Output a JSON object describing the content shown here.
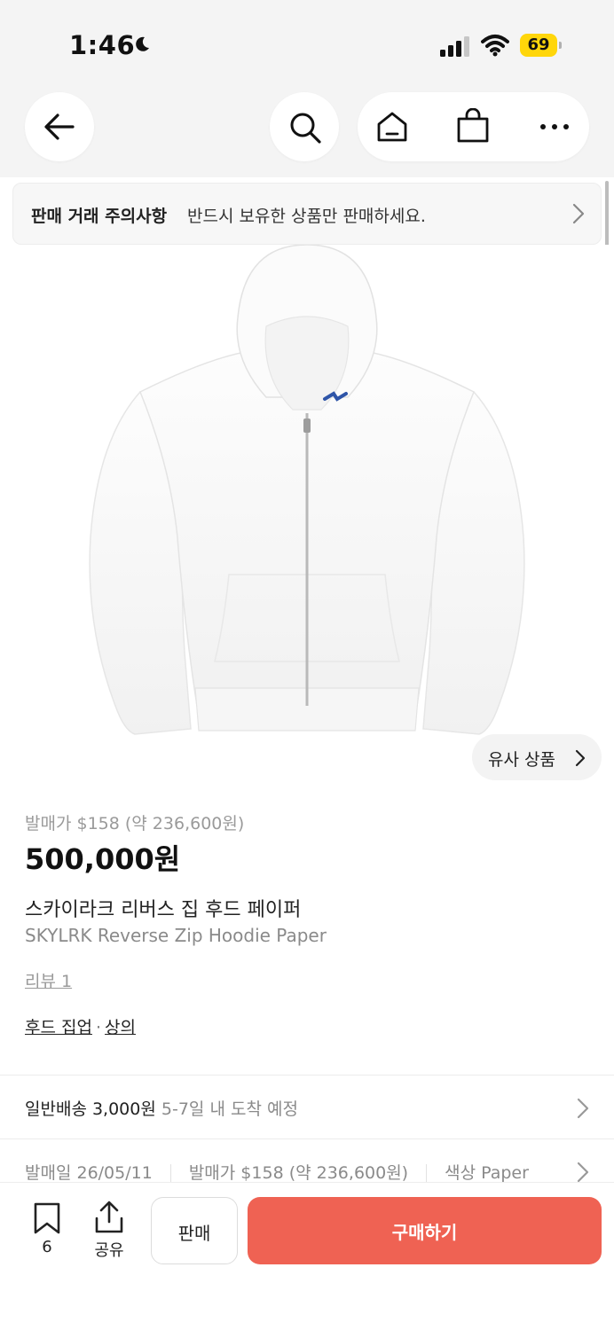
{
  "status_bar": {
    "time": "1:46",
    "battery": "69"
  },
  "nav": {
    "back_icon": "arrow-left-icon",
    "search_icon": "search-icon",
    "home_icon": "home-icon",
    "cart_icon": "shopping-bag-icon",
    "more_icon": "more-horizontal-icon"
  },
  "notice": {
    "title": "판매 거래 주의사항",
    "text": "반드시 보유한 상품만 판매하세요."
  },
  "product": {
    "image_alt_icon": "white-zip-hoodie-image",
    "similar_label": "유사 상품",
    "release_price": "발매가 $158 (약 236,600원)",
    "price": "500,000원",
    "name_ko": "스카이라크 리버스 집 후드 페이퍼",
    "name_en": "SKYLRK Reverse Zip Hoodie Paper",
    "review": "리뷰 1",
    "category_1": "후드 집업",
    "category_sep": "·",
    "category_2": "상의"
  },
  "shipping": {
    "main": "일반배송 3,000원",
    "eta": "5-7일 내 도착 예정"
  },
  "details": {
    "release_date": "발매일 26/05/11",
    "release_price": "발매가 $158 (약 236,600원)",
    "color": "색상 Paper"
  },
  "bottom": {
    "bookmark_count": "6",
    "share_label": "공유",
    "sell_label": "판매",
    "buy_label": "구매하기"
  },
  "colors": {
    "buy_button": "#ef6253",
    "battery": "#ffd60a"
  }
}
